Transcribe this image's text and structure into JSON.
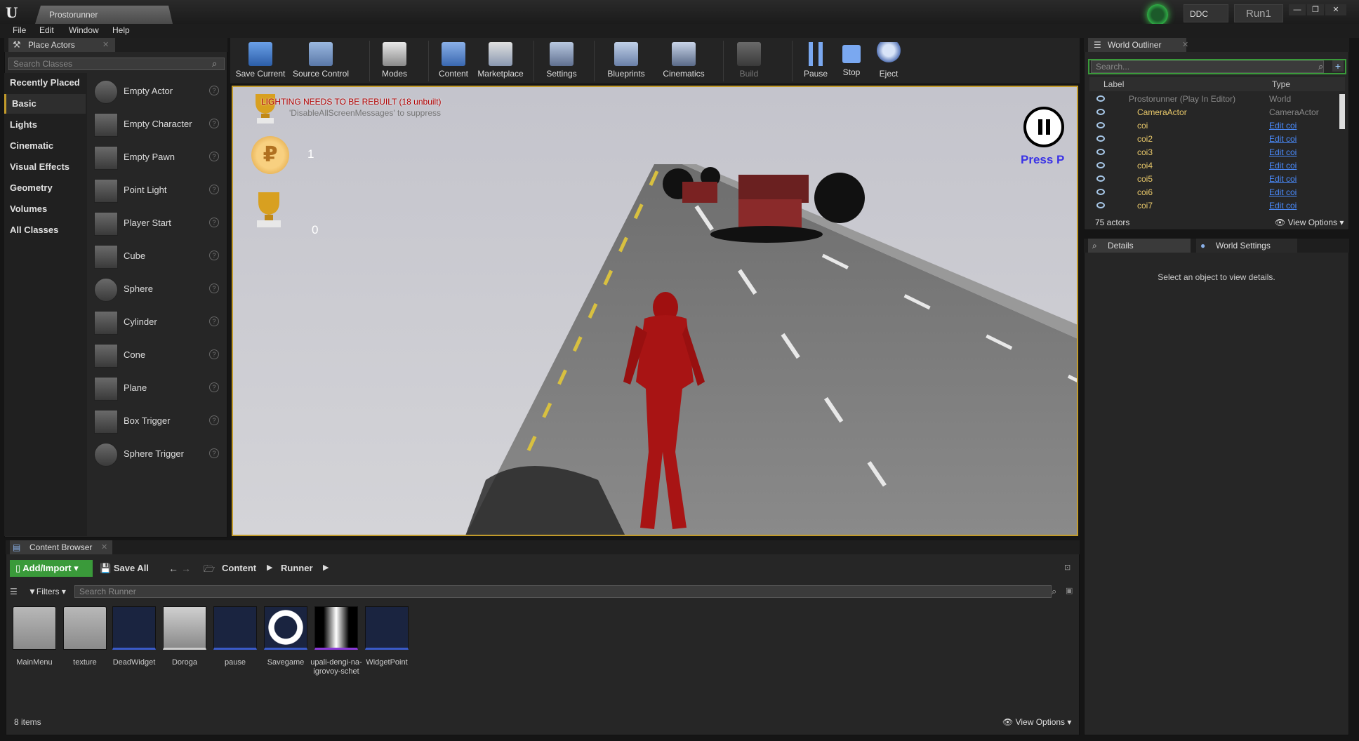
{
  "title_bar": {
    "doc_tab": "Prostorunner",
    "ddc": "DDC",
    "run": "Run1",
    "min": "—",
    "max": "❐",
    "close": "✕"
  },
  "menu": [
    "File",
    "Edit",
    "Window",
    "Help"
  ],
  "place_actors": {
    "tab": "Place Actors",
    "search_placeholder": "Search Classes",
    "categories": [
      "Recently Placed",
      "Basic",
      "Lights",
      "Cinematic",
      "Visual Effects",
      "Geometry",
      "Volumes",
      "All Classes"
    ],
    "selected_category": "Basic",
    "items": [
      "Empty Actor",
      "Empty Character",
      "Empty Pawn",
      "Point Light",
      "Player Start",
      "Cube",
      "Sphere",
      "Cylinder",
      "Cone",
      "Plane",
      "Box Trigger",
      "Sphere Trigger"
    ]
  },
  "toolbar": {
    "buttons": [
      "Save Current",
      "Source Control",
      "Modes",
      "Content",
      "Marketplace",
      "Settings",
      "Blueprints",
      "Cinematics",
      "Build",
      "Pause",
      "Stop",
      "Eject"
    ]
  },
  "viewport": {
    "lighting_warning": "LIGHTING NEEDS TO BE REBUILT (18 unbuilt)",
    "suppress_hint": "'DisableAllScreenMessages' to suppress",
    "coins_value": "1",
    "trophy_value": "0",
    "press_p": "Press P"
  },
  "world_outliner": {
    "tab": "World Outliner",
    "search_placeholder": "Search...",
    "col_label": "Label",
    "col_type": "Type",
    "rows": [
      {
        "label": "Prostorunner (Play In Editor)",
        "type": "World"
      },
      {
        "label": "CameraActor",
        "type": "CameraActor"
      },
      {
        "label": "coi",
        "type": "Edit coi"
      },
      {
        "label": "coi2",
        "type": "Edit coi"
      },
      {
        "label": "coi3",
        "type": "Edit coi"
      },
      {
        "label": "coi4",
        "type": "Edit coi"
      },
      {
        "label": "coi5",
        "type": "Edit coi"
      },
      {
        "label": "coi6",
        "type": "Edit coi"
      },
      {
        "label": "coi7",
        "type": "Edit coi"
      }
    ],
    "actors_count": "75 actors",
    "view_options": "View Options"
  },
  "details": {
    "tab_details": "Details",
    "tab_world_settings": "World Settings",
    "empty_text": "Select an object to view details."
  },
  "content_browser": {
    "tab": "Content Browser",
    "add_import": "Add/Import",
    "save_all": "Save All",
    "path": [
      "Content",
      "Runner"
    ],
    "filters": "Filters",
    "search_placeholder": "Search Runner",
    "assets": [
      "MainMenu",
      "texture",
      "DeadWidget",
      "Doroga",
      "pause",
      "Savegame",
      "upali-dengi-na-igrovoy-schet",
      "WidgetPoint"
    ],
    "items_count": "8 items",
    "view_options": "View Options"
  },
  "colors": {
    "accent_gold": "#c29b2b",
    "link_blue": "#4a8cff",
    "add_green": "#3a9a3a",
    "warning_red": "#b00000",
    "press_p_blue": "#3a32e6"
  }
}
